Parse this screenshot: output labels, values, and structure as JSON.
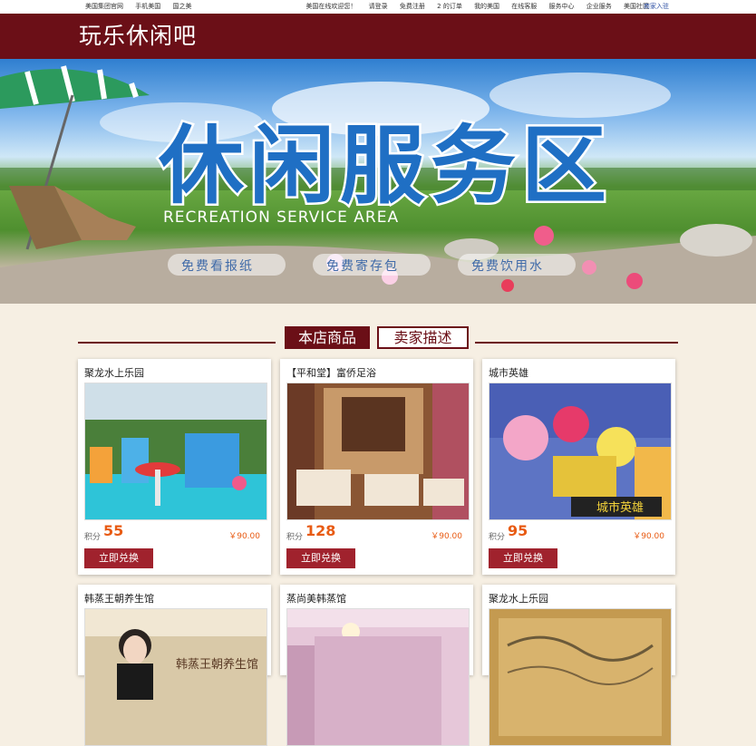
{
  "topbar": {
    "left_links": [
      "美国集团官网",
      "手机美国",
      "国之美"
    ],
    "right_links": [
      "美国在线欢迎您！",
      "请登录",
      "免费注册",
      "2 的订单",
      "我的美国",
      "在线客服",
      "服务中心",
      "企业服务",
      "美国社区"
    ],
    "merchant_link": "商家入驻"
  },
  "header": {
    "shop_name": "玩乐休闲吧"
  },
  "banner": {
    "title_cn": "休闲服务区",
    "title_en": "RECREATION SERVICE AREA",
    "perks": [
      "免费看报纸",
      "免费寄存包",
      "免费饮用水"
    ]
  },
  "tabs": [
    "本店商品",
    "卖家描述"
  ],
  "products": [
    {
      "name": "聚龙水上乐园",
      "points_label": "积分",
      "points": "55",
      "price": "￥90.00",
      "button": "立即兑换"
    },
    {
      "name": "【平和堂】富侨足浴",
      "points_label": "积分",
      "points": "128",
      "price": "￥90.00",
      "button": "立即兑换"
    },
    {
      "name": "城市英雄",
      "points_label": "积分",
      "points": "95",
      "price": "￥90.00",
      "button": "立即兑换"
    },
    {
      "name": "韩蒸王朝养生馆",
      "points_label": "",
      "points": "",
      "price": "",
      "button": ""
    },
    {
      "name": "蒸尚美韩蒸馆",
      "points_label": "",
      "points": "",
      "price": "",
      "button": ""
    },
    {
      "name": "聚龙水上乐园",
      "points_label": "",
      "points": "",
      "price": "",
      "button": ""
    }
  ],
  "image_texts": {
    "hero_sign": "城市英雄",
    "spa_sign": "韩蒸王朝养生馆"
  },
  "colors": {
    "brand": "#6b0f17",
    "button": "#a0222d",
    "accent": "#e85b13",
    "page_bg": "#f6efe3"
  }
}
